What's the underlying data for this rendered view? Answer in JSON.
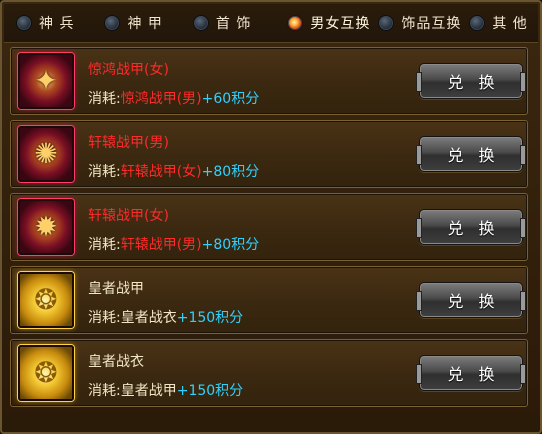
{
  "tabs": [
    {
      "label": "神 兵",
      "active": false
    },
    {
      "label": "神 甲",
      "active": false
    },
    {
      "label": "首 饰",
      "active": false
    },
    {
      "label": "男女互换",
      "active": true
    },
    {
      "label": "饰品互换",
      "active": false
    },
    {
      "label": "其 他",
      "active": false
    }
  ],
  "items": [
    {
      "name": "惊鸿战甲(女)",
      "cost_prefix": "消耗:",
      "cost_item": "惊鸿战甲(男)",
      "cost_points": "+60积分",
      "button": "兑 换",
      "rarity_color": "red",
      "icon": "armor-icon"
    },
    {
      "name": "轩辕战甲(男)",
      "cost_prefix": "消耗:",
      "cost_item": "轩辕战甲(女)",
      "cost_points": "+80积分",
      "button": "兑 换",
      "rarity_color": "red",
      "icon": "armor-icon"
    },
    {
      "name": "轩辕战甲(女)",
      "cost_prefix": "消耗:",
      "cost_item": "轩辕战甲(男)",
      "cost_points": "+80积分",
      "button": "兑 换",
      "rarity_color": "red",
      "icon": "armor-icon"
    },
    {
      "name": "皇者战甲",
      "cost_prefix": "消耗:",
      "cost_item": "皇者战衣",
      "cost_points": "+150积分",
      "button": "兑 换",
      "rarity_color": "gold",
      "icon": "armor-icon"
    },
    {
      "name": "皇者战衣",
      "cost_prefix": "消耗:",
      "cost_item": "皇者战甲",
      "cost_points": "+150积分",
      "button": "兑 换",
      "rarity_color": "gold",
      "icon": "armor-icon"
    }
  ],
  "colors": {
    "red_item": "#ff2a2a",
    "points": "#2fd2ff",
    "text": "#f2e6c4"
  }
}
